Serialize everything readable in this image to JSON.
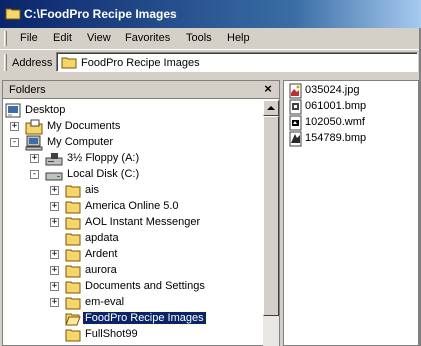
{
  "window": {
    "title": "C:\\FoodPro Recipe Images"
  },
  "menu": {
    "items": [
      "File",
      "Edit",
      "View",
      "Favorites",
      "Tools",
      "Help"
    ]
  },
  "address": {
    "label": "Address",
    "value": "FoodPro Recipe Images"
  },
  "folders_pane": {
    "title": "Folders",
    "close_glyph": "×",
    "tree": [
      {
        "label": "Desktop",
        "icon": "desktop-icon"
      },
      {
        "label": "My Documents",
        "icon": "my-documents-icon",
        "expander": "+"
      },
      {
        "label": "My Computer",
        "icon": "my-computer-icon",
        "expander": "-"
      },
      {
        "label": "3½ Floppy (A:)",
        "icon": "floppy-drive-icon",
        "expander": "+"
      },
      {
        "label": "Local Disk (C:)",
        "icon": "hard-drive-icon",
        "expander": "-"
      },
      {
        "label": "ais",
        "icon": "folder-icon",
        "expander": "+"
      },
      {
        "label": "America Online 5.0",
        "icon": "folder-icon",
        "expander": "+"
      },
      {
        "label": "AOL Instant Messenger",
        "icon": "folder-icon",
        "expander": "+"
      },
      {
        "label": "apdata",
        "icon": "folder-icon"
      },
      {
        "label": "Ardent",
        "icon": "folder-icon",
        "expander": "+"
      },
      {
        "label": "aurora",
        "icon": "folder-icon",
        "expander": "+"
      },
      {
        "label": "Documents and Settings",
        "icon": "folder-icon",
        "expander": "+"
      },
      {
        "label": "em-eval",
        "icon": "folder-icon",
        "expander": "+"
      },
      {
        "label": "FoodPro Recipe Images",
        "icon": "open-folder-icon",
        "selected": true
      },
      {
        "label": "FullShot99",
        "icon": "folder-icon"
      }
    ]
  },
  "files": [
    {
      "name": "035024.jpg",
      "icon": "jpg-file-icon"
    },
    {
      "name": "061001.bmp",
      "icon": "bmp-file-icon"
    },
    {
      "name": "102050.wmf",
      "icon": "wmf-file-icon"
    },
    {
      "name": "154789.bmp",
      "icon": "bmp-file-icon"
    }
  ],
  "colors": {
    "titlebar_start": "#0a246a",
    "titlebar_end": "#a6caf0",
    "selection": "#0a246a",
    "folder": "#f6d66b"
  }
}
